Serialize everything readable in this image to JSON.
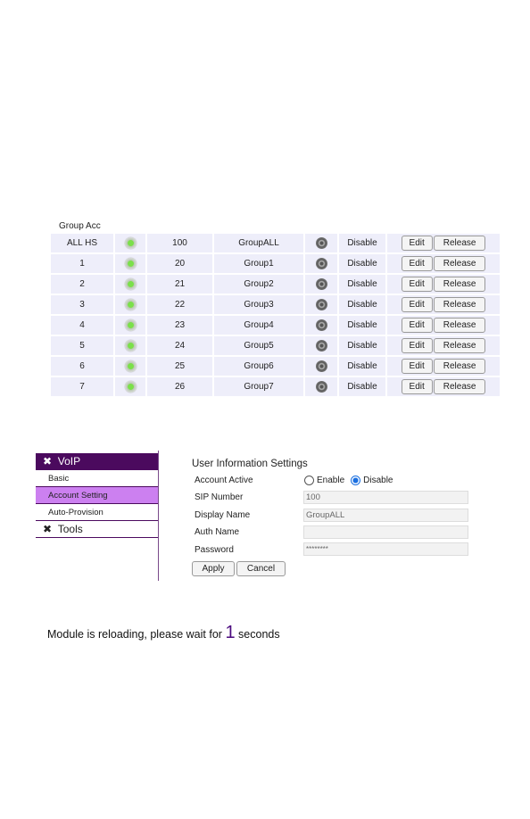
{
  "group_table": {
    "title": "Group Acc",
    "edit_label": "Edit",
    "release_label": "Release",
    "rows": [
      {
        "id": "ALL HS",
        "num": "100",
        "name": "GroupALL",
        "status": "Disable"
      },
      {
        "id": "1",
        "num": "20",
        "name": "Group1",
        "status": "Disable"
      },
      {
        "id": "2",
        "num": "21",
        "name": "Group2",
        "status": "Disable"
      },
      {
        "id": "3",
        "num": "22",
        "name": "Group3",
        "status": "Disable"
      },
      {
        "id": "4",
        "num": "23",
        "name": "Group4",
        "status": "Disable"
      },
      {
        "id": "5",
        "num": "24",
        "name": "Group5",
        "status": "Disable"
      },
      {
        "id": "6",
        "num": "25",
        "name": "Group6",
        "status": "Disable"
      },
      {
        "id": "7",
        "num": "26",
        "name": "Group7",
        "status": "Disable"
      }
    ]
  },
  "sidebar": {
    "section1": "VoIP",
    "items": [
      "Basic",
      "Account Setting",
      "Auto-Provision"
    ],
    "section2": "Tools",
    "active": "Account Setting",
    "header_color": "#4b0a5e",
    "active_color": "#cc80f0"
  },
  "form": {
    "title": "User Information Settings",
    "account_active_label": "Account Active",
    "enable_label": "Enable",
    "disable_label": "Disable",
    "selected": "Disable",
    "sip_label": "SIP Number",
    "sip_value": "100",
    "display_label": "Display Name",
    "display_value": "GroupALL",
    "auth_label": "Auth Name",
    "auth_value": "",
    "password_label": "Password",
    "password_value": "********",
    "apply_label": "Apply",
    "cancel_label": "Cancel"
  },
  "message": {
    "prefix": "Module is reloading, please wait for",
    "count": "1",
    "suffix": "seconds"
  }
}
